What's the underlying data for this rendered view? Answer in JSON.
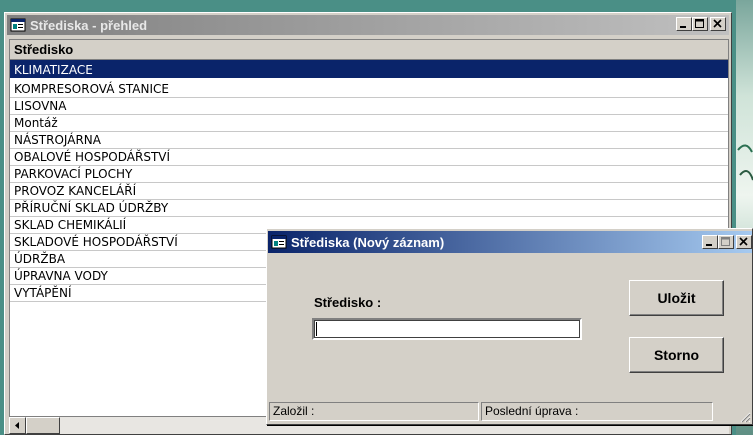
{
  "main_window": {
    "title": "Střediska - přehled",
    "column_header": "Středisko",
    "rows": [
      "KLIMATIZACE",
      "KOMPRESOROVÁ STANICE",
      "LISOVNA",
      "Montáž",
      "NÁSTROJÁRNA",
      "OBALOVÉ HOSPODÁŘSTVÍ",
      "PARKOVACÍ PLOCHY",
      "PROVOZ  KANCELÁŘÍ",
      "PŘÍRUČNÍ SKLAD ÚDRŽBY",
      "SKLAD CHEMIKÁLIÍ",
      "SKLADOVÉ HOSPODÁŘSTVÍ",
      "ÚDRŽBA",
      "ÚPRAVNA VODY",
      "VYTÁPĚNÍ"
    ],
    "selected_row": "KLIMATIZACE"
  },
  "dialog": {
    "title": "Střediska (Nový záznam)",
    "field_label": "Středisko :",
    "field_value": "",
    "save_label": "Uložit",
    "cancel_label": "Storno",
    "status_created": "Založil :",
    "status_modified": "Poslední úprava :"
  },
  "colors": {
    "selection": "#0a246a",
    "inactive_title": "#808080",
    "active_title": "#0a246a",
    "face": "#d4d0c8"
  }
}
